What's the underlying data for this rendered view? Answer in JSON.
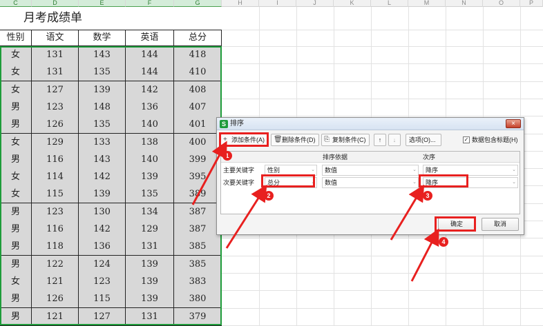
{
  "sheet": {
    "col_letters": [
      "C",
      "D",
      "E",
      "F",
      "G",
      "H",
      "I",
      "J",
      "K",
      "L",
      "M",
      "N",
      "O",
      "P"
    ],
    "title": "月考成绩单",
    "headers": [
      "性别",
      "语文",
      "数学",
      "英语",
      "总分"
    ],
    "rows": [
      [
        "女",
        "131",
        "143",
        "144",
        "418"
      ],
      [
        "女",
        "131",
        "135",
        "144",
        "410"
      ],
      [
        "女",
        "127",
        "139",
        "142",
        "408"
      ],
      [
        "男",
        "123",
        "148",
        "136",
        "407"
      ],
      [
        "男",
        "126",
        "135",
        "140",
        "401"
      ],
      [
        "女",
        "129",
        "133",
        "138",
        "400"
      ],
      [
        "男",
        "116",
        "143",
        "140",
        "399"
      ],
      [
        "女",
        "114",
        "142",
        "139",
        "395"
      ],
      [
        "女",
        "115",
        "139",
        "135",
        "389"
      ],
      [
        "男",
        "123",
        "130",
        "134",
        "387"
      ],
      [
        "男",
        "116",
        "142",
        "129",
        "387"
      ],
      [
        "男",
        "118",
        "136",
        "131",
        "385"
      ],
      [
        "男",
        "122",
        "124",
        "139",
        "385"
      ],
      [
        "女",
        "121",
        "123",
        "139",
        "383"
      ],
      [
        "男",
        "126",
        "115",
        "139",
        "380"
      ],
      [
        "男",
        "121",
        "127",
        "131",
        "379"
      ]
    ]
  },
  "dialog": {
    "logo": "S",
    "title": "排序",
    "close": "×",
    "add_condition": "添加条件(A)",
    "delete_condition": "删除条件(D)",
    "copy_condition": "复制条件(C)",
    "move_up": "↑",
    "move_down": "↓",
    "options": "选项(O)...",
    "has_header_label": "数据包含标题(H)",
    "has_header_check": "✓",
    "col_basis": "排序依据",
    "col_order": "次序",
    "rows": [
      {
        "label": "主要关键字",
        "key": "性别",
        "basis": "数值",
        "order": "降序"
      },
      {
        "label": "次要关键字",
        "key": "总分",
        "basis": "数值",
        "order": "降序"
      }
    ],
    "ok": "确定",
    "cancel": "取消"
  },
  "icons": {
    "add": "+",
    "delete": "🗑",
    "copy": "⎘",
    "dropdown": "⌄"
  },
  "markers": [
    "1",
    "2",
    "3",
    "4"
  ],
  "colors": {
    "highlight_red": "#e8201f",
    "selection_green": "#1e9c3a"
  }
}
